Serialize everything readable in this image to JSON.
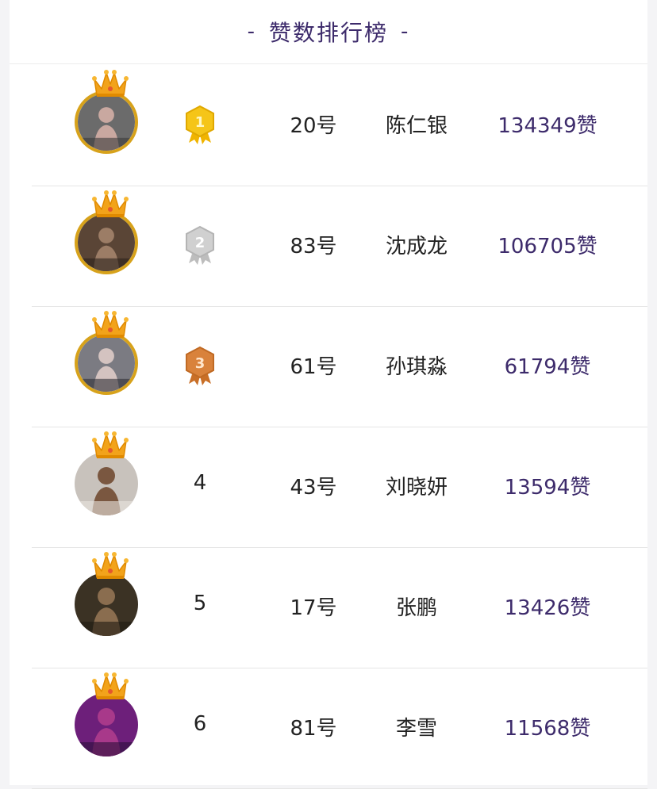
{
  "header": {
    "title": "赞数排行榜",
    "dash_left": "-",
    "dash_right": "-"
  },
  "colors": {
    "accent": "#3d2b6b",
    "gold": "#d7a21b",
    "crown": "#f2a31b",
    "silver": "#c3c3c3",
    "bronze": "#d27a34"
  },
  "rows": [
    {
      "rank": "1",
      "medal": "gold",
      "number": "20号",
      "name": "陈仁银",
      "likes": "134349赞",
      "avatar_style": "gold"
    },
    {
      "rank": "2",
      "medal": "silver",
      "number": "83号",
      "name": "沈成龙",
      "likes": "106705赞",
      "avatar_style": "gold"
    },
    {
      "rank": "3",
      "medal": "bronze",
      "number": "61号",
      "name": "孙琪淼",
      "likes": "61794赞",
      "avatar_style": "gold"
    },
    {
      "rank": "4",
      "medal": "none",
      "number": "43号",
      "name": "刘晓妍",
      "likes": "13594赞",
      "avatar_style": "plain"
    },
    {
      "rank": "5",
      "medal": "none",
      "number": "17号",
      "name": "张鹏",
      "likes": "13426赞",
      "avatar_style": "plain"
    },
    {
      "rank": "6",
      "medal": "none",
      "number": "81号",
      "name": "李雪",
      "likes": "11568赞",
      "avatar_style": "plain"
    }
  ]
}
